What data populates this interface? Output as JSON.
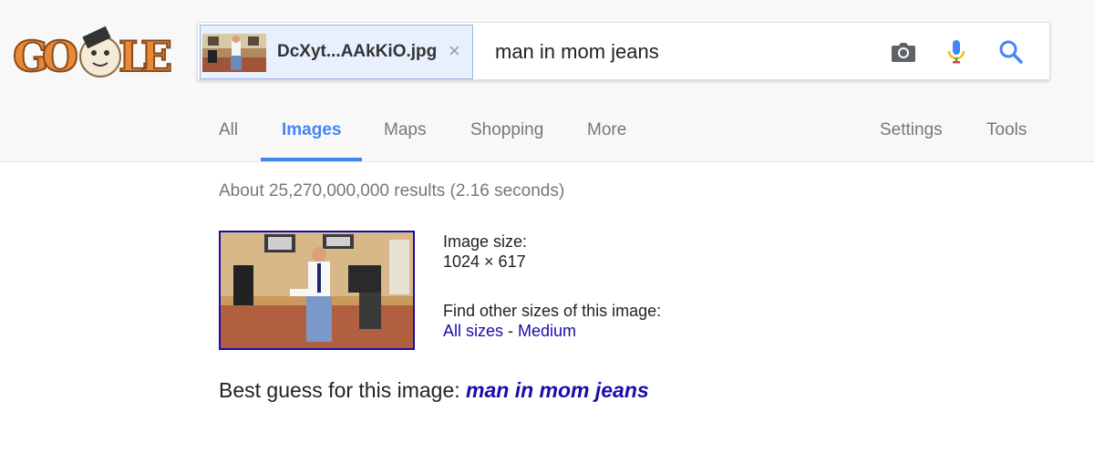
{
  "logo": {
    "text": "GOOGLE",
    "icon": "doodle-logo"
  },
  "search": {
    "image_chip": {
      "filename": "DcXyt...AAkKiO.jpg",
      "close_label": "×"
    },
    "query": "man in mom jeans",
    "icons": [
      "camera-icon",
      "microphone-icon",
      "search-icon"
    ]
  },
  "tabs": [
    {
      "label": "All"
    },
    {
      "label": "Images",
      "active": true
    },
    {
      "label": "Maps"
    },
    {
      "label": "Shopping"
    },
    {
      "label": "More"
    }
  ],
  "tools": {
    "settings": "Settings",
    "tools": "Tools"
  },
  "results": {
    "stats": "About 25,270,000,000 results (2.16 seconds)",
    "image_size_label": "Image size:",
    "image_size_value": "1024 × 617",
    "find_other_label": "Find other sizes of this image:",
    "all_sizes_link": "All sizes",
    "separator": " - ",
    "medium_link": "Medium",
    "best_guess_label": "Best guess for this image: ",
    "best_guess_link": "man in mom jeans"
  },
  "colors": {
    "accent": "#4285f4",
    "link": "#1a0dab",
    "header_bg": "#f8f8f8",
    "chip_bg": "#e8f0fe"
  }
}
